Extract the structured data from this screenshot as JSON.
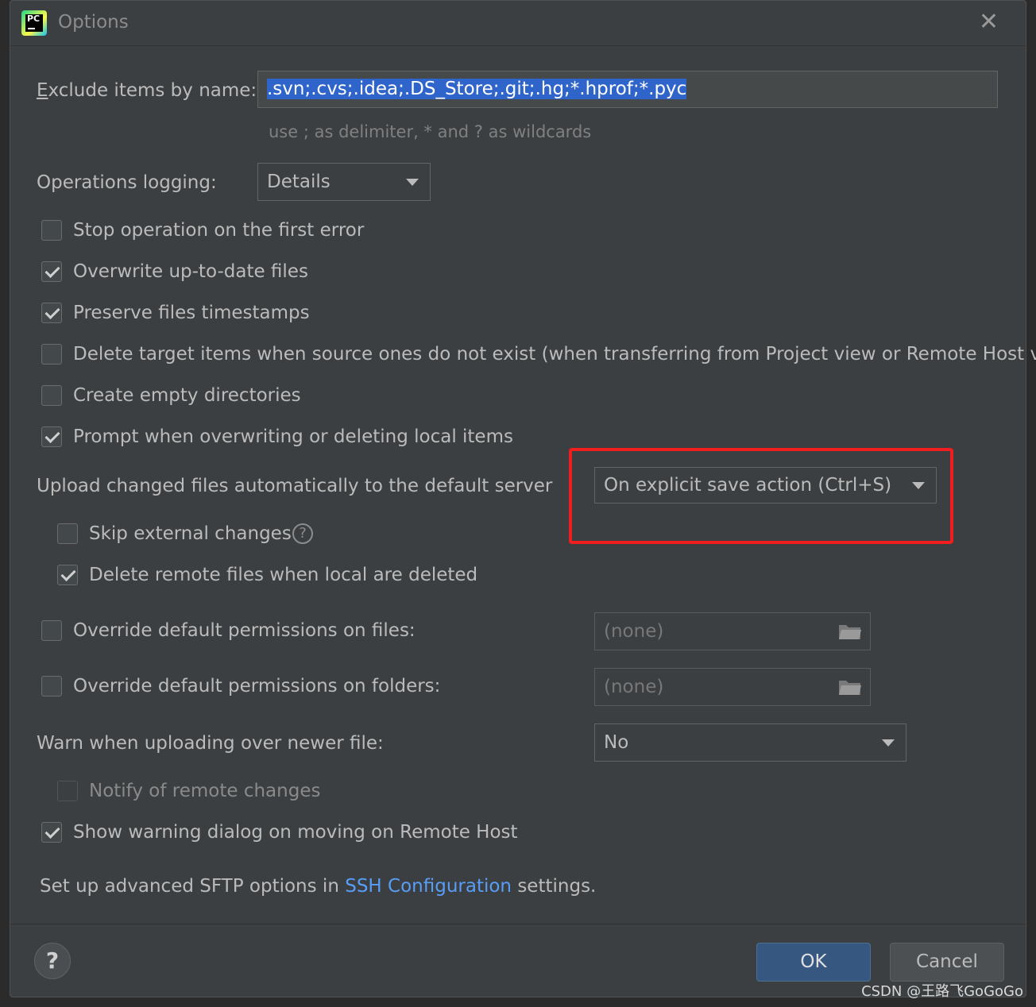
{
  "dialog": {
    "title": "Options",
    "close_glyph": "✕"
  },
  "exclude": {
    "label_mnemonic": "E",
    "label_rest": "xclude items by name:",
    "value": ".svn;.cvs;.idea;.DS_Store;.git;.hg;*.hprof;*.pyc",
    "hint": "use ; as delimiter, * and ? as wildcards"
  },
  "logging": {
    "label": "Operations logging:",
    "value": "Details"
  },
  "options": [
    {
      "label": "Stop operation on the first error",
      "checked": false
    },
    {
      "label": "Overwrite up-to-date files",
      "checked": true
    },
    {
      "label": "Preserve files timestamps",
      "checked": true
    },
    {
      "label": "Delete target items when source ones do not exist (when transferring from Project view or Remote Host view)",
      "checked": false
    },
    {
      "label": "Create empty directories",
      "checked": false
    },
    {
      "label": "Prompt when overwriting or deleting local items",
      "checked": true
    }
  ],
  "upload": {
    "label": "Upload changed files automatically to the default server",
    "value": "On explicit save action (Ctrl+S)",
    "skip_external": {
      "label": "Skip external changes",
      "checked": false
    },
    "delete_remote": {
      "label": "Delete remote files when local are deleted",
      "checked": true
    }
  },
  "permissions": {
    "files_label": "Override default permissions on files:",
    "files_value": "(none)",
    "folders_label": "Override default permissions on folders:",
    "folders_value": "(none)"
  },
  "warn": {
    "label": "Warn when uploading over newer file:",
    "value": "No"
  },
  "notify_remote": {
    "label": "Notify of remote changes",
    "checked": false,
    "disabled": true
  },
  "show_warning": {
    "label": "Show warning dialog on moving on Remote Host",
    "checked": true
  },
  "sftp": {
    "prefix": "Set up advanced SFTP options in",
    "link": "SSH Configuration",
    "suffix": "settings."
  },
  "buttons": {
    "help": "?",
    "ok": "OK",
    "cancel": "Cancel"
  },
  "watermark": "CSDN @王路飞GoGoGo",
  "colors": {
    "background": "#3c3f41",
    "accent": "#365880",
    "link": "#589df6",
    "highlight_box": "#f01e1e",
    "selection": "#2f65ca"
  }
}
